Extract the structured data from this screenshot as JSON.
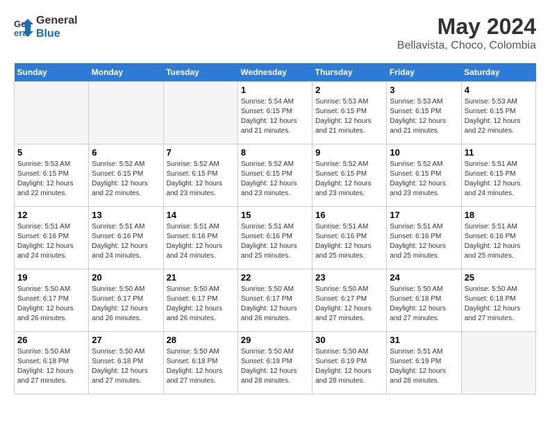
{
  "header": {
    "logo_line1": "General",
    "logo_line2": "Blue",
    "title": "May 2024",
    "subtitle": "Bellavista, Choco, Colombia"
  },
  "calendar": {
    "days_of_week": [
      "Sunday",
      "Monday",
      "Tuesday",
      "Wednesday",
      "Thursday",
      "Friday",
      "Saturday"
    ],
    "weeks": [
      [
        {
          "day": "",
          "info": ""
        },
        {
          "day": "",
          "info": ""
        },
        {
          "day": "",
          "info": ""
        },
        {
          "day": "1",
          "info": "Sunrise: 5:54 AM\nSunset: 6:15 PM\nDaylight: 12 hours\nand 21 minutes."
        },
        {
          "day": "2",
          "info": "Sunrise: 5:53 AM\nSunset: 6:15 PM\nDaylight: 12 hours\nand 21 minutes."
        },
        {
          "day": "3",
          "info": "Sunrise: 5:53 AM\nSunset: 6:15 PM\nDaylight: 12 hours\nand 21 minutes."
        },
        {
          "day": "4",
          "info": "Sunrise: 5:53 AM\nSunset: 6:15 PM\nDaylight: 12 hours\nand 22 minutes."
        }
      ],
      [
        {
          "day": "5",
          "info": "Sunrise: 5:53 AM\nSunset: 6:15 PM\nDaylight: 12 hours\nand 22 minutes."
        },
        {
          "day": "6",
          "info": "Sunrise: 5:52 AM\nSunset: 6:15 PM\nDaylight: 12 hours\nand 22 minutes."
        },
        {
          "day": "7",
          "info": "Sunrise: 5:52 AM\nSunset: 6:15 PM\nDaylight: 12 hours\nand 23 minutes."
        },
        {
          "day": "8",
          "info": "Sunrise: 5:52 AM\nSunset: 6:15 PM\nDaylight: 12 hours\nand 23 minutes."
        },
        {
          "day": "9",
          "info": "Sunrise: 5:52 AM\nSunset: 6:15 PM\nDaylight: 12 hours\nand 23 minutes."
        },
        {
          "day": "10",
          "info": "Sunrise: 5:52 AM\nSunset: 6:15 PM\nDaylight: 12 hours\nand 23 minutes."
        },
        {
          "day": "11",
          "info": "Sunrise: 5:51 AM\nSunset: 6:15 PM\nDaylight: 12 hours\nand 24 minutes."
        }
      ],
      [
        {
          "day": "12",
          "info": "Sunrise: 5:51 AM\nSunset: 6:16 PM\nDaylight: 12 hours\nand 24 minutes."
        },
        {
          "day": "13",
          "info": "Sunrise: 5:51 AM\nSunset: 6:16 PM\nDaylight: 12 hours\nand 24 minutes."
        },
        {
          "day": "14",
          "info": "Sunrise: 5:51 AM\nSunset: 6:16 PM\nDaylight: 12 hours\nand 24 minutes."
        },
        {
          "day": "15",
          "info": "Sunrise: 5:51 AM\nSunset: 6:16 PM\nDaylight: 12 hours\nand 25 minutes."
        },
        {
          "day": "16",
          "info": "Sunrise: 5:51 AM\nSunset: 6:16 PM\nDaylight: 12 hours\nand 25 minutes."
        },
        {
          "day": "17",
          "info": "Sunrise: 5:51 AM\nSunset: 6:16 PM\nDaylight: 12 hours\nand 25 minutes."
        },
        {
          "day": "18",
          "info": "Sunrise: 5:51 AM\nSunset: 6:16 PM\nDaylight: 12 hours\nand 25 minutes."
        }
      ],
      [
        {
          "day": "19",
          "info": "Sunrise: 5:50 AM\nSunset: 6:17 PM\nDaylight: 12 hours\nand 26 minutes."
        },
        {
          "day": "20",
          "info": "Sunrise: 5:50 AM\nSunset: 6:17 PM\nDaylight: 12 hours\nand 26 minutes."
        },
        {
          "day": "21",
          "info": "Sunrise: 5:50 AM\nSunset: 6:17 PM\nDaylight: 12 hours\nand 26 minutes."
        },
        {
          "day": "22",
          "info": "Sunrise: 5:50 AM\nSunset: 6:17 PM\nDaylight: 12 hours\nand 26 minutes."
        },
        {
          "day": "23",
          "info": "Sunrise: 5:50 AM\nSunset: 6:17 PM\nDaylight: 12 hours\nand 27 minutes."
        },
        {
          "day": "24",
          "info": "Sunrise: 5:50 AM\nSunset: 6:18 PM\nDaylight: 12 hours\nand 27 minutes."
        },
        {
          "day": "25",
          "info": "Sunrise: 5:50 AM\nSunset: 6:18 PM\nDaylight: 12 hours\nand 27 minutes."
        }
      ],
      [
        {
          "day": "26",
          "info": "Sunrise: 5:50 AM\nSunset: 6:18 PM\nDaylight: 12 hours\nand 27 minutes."
        },
        {
          "day": "27",
          "info": "Sunrise: 5:50 AM\nSunset: 6:18 PM\nDaylight: 12 hours\nand 27 minutes."
        },
        {
          "day": "28",
          "info": "Sunrise: 5:50 AM\nSunset: 6:18 PM\nDaylight: 12 hours\nand 27 minutes."
        },
        {
          "day": "29",
          "info": "Sunrise: 5:50 AM\nSunset: 6:19 PM\nDaylight: 12 hours\nand 28 minutes."
        },
        {
          "day": "30",
          "info": "Sunrise: 5:50 AM\nSunset: 6:19 PM\nDaylight: 12 hours\nand 28 minutes."
        },
        {
          "day": "31",
          "info": "Sunrise: 5:51 AM\nSunset: 6:19 PM\nDaylight: 12 hours\nand 28 minutes."
        },
        {
          "day": "",
          "info": ""
        }
      ]
    ]
  }
}
